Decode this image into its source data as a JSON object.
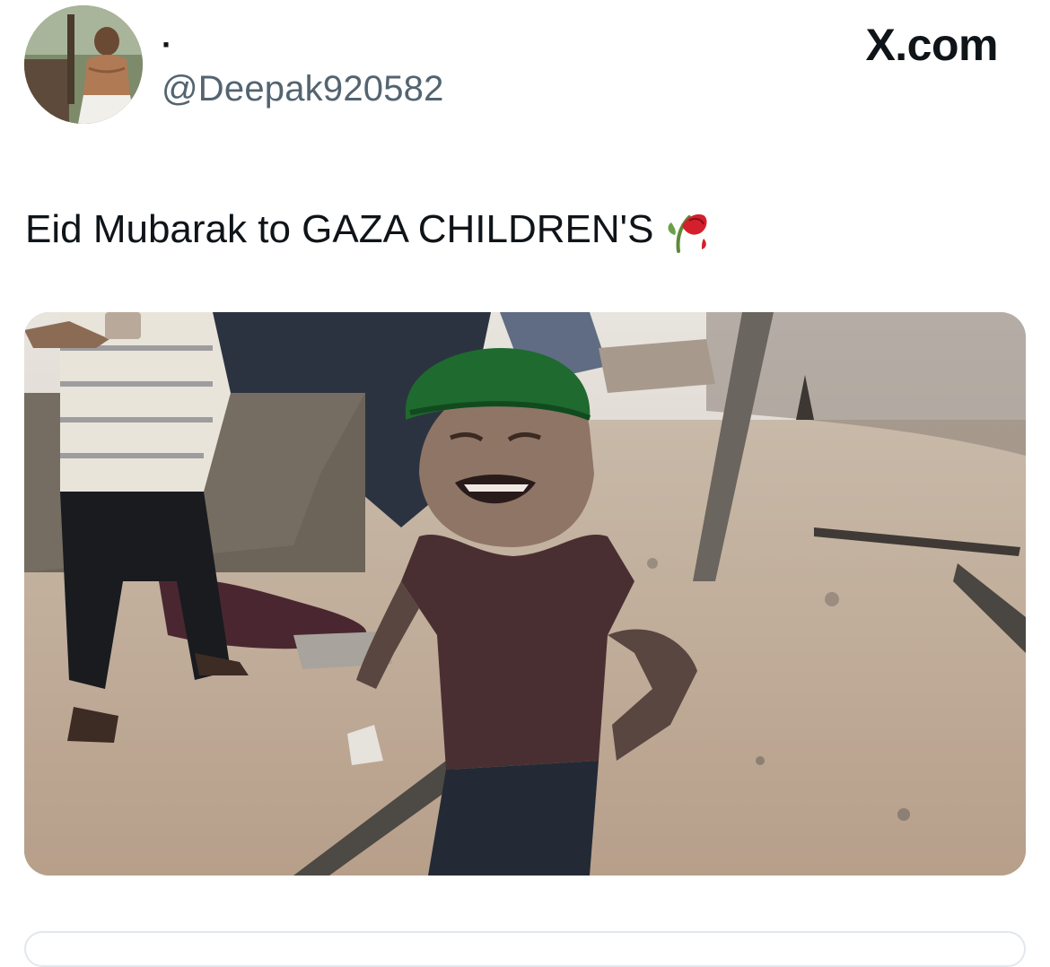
{
  "author": {
    "display_name": "·",
    "handle": "@Deepak920582",
    "avatar_icon": "profile-photo"
  },
  "brand": {
    "label": "X.com"
  },
  "tweet": {
    "text": "Eid Mubarak to GAZA CHILDREN'S",
    "emoji_icon": "wilted-rose-icon"
  },
  "colors": {
    "text_primary": "#0f1419",
    "text_secondary": "#536471",
    "divider": "#e1e8ed"
  }
}
